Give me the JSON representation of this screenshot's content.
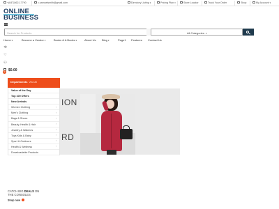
{
  "topbar": {
    "phone": "+(647)562-17790",
    "email": "c.samuelsmith@gmail.com",
    "currency": "Directory Listing",
    "language": "Pricing Plan",
    "store_locator": "Store Locator",
    "track_order": "Track Your Order",
    "shop": "Shop",
    "account": "My Account"
  },
  "logo": {
    "line1": "ONLINE",
    "line2": "BUSINESS"
  },
  "search": {
    "placeholder": "Search for Products",
    "category": "All Categories"
  },
  "nav": [
    {
      "label": "Home",
      "has_caret": true
    },
    {
      "label": "Become a Vendor",
      "has_caret": true
    },
    {
      "label": "Books & A Books",
      "has_caret": true
    },
    {
      "label": "About Us",
      "has_caret": false
    },
    {
      "label": "Blog",
      "has_caret": true
    },
    {
      "label": "Page1",
      "has_caret": false
    },
    {
      "label": "Features",
      "has_caret": false
    },
    {
      "label": "Contact Us",
      "has_caret": false
    }
  ],
  "header_icons": [
    "compare-icon",
    "heart-icon",
    "user-icon"
  ],
  "cart": {
    "count": "0",
    "total": "$0.00"
  },
  "departments": {
    "title": "Departments",
    "view_all": "View All",
    "items": [
      {
        "label": "Value of the Day",
        "bold": true,
        "arrow": false
      },
      {
        "label": "Top 100 Offers",
        "bold": true,
        "arrow": false
      },
      {
        "label": "New Arrivals",
        "bold": true,
        "arrow": false
      },
      {
        "label": "Women Clothing",
        "bold": false,
        "arrow": true
      },
      {
        "label": "Men's Clothing",
        "bold": false,
        "arrow": true
      },
      {
        "label": "Bags & Shoes",
        "bold": false,
        "arrow": true
      },
      {
        "label": "Beauty, Health & Hair",
        "bold": false,
        "arrow": true
      },
      {
        "label": "Jewelry & Watches",
        "bold": false,
        "arrow": true
      },
      {
        "label": "Toys Kids & Baby",
        "bold": false,
        "arrow": true
      },
      {
        "label": "Sport & Outdoors",
        "bold": false,
        "arrow": true
      },
      {
        "label": "Health & Wellness",
        "bold": false,
        "arrow": true
      },
      {
        "label": "Downloadable Products",
        "bold": false,
        "arrow": false
      }
    ]
  },
  "hero": {
    "word1": "ION",
    "word2": "RD"
  },
  "deals": {
    "prefix": "CATCH BIG",
    "highlight": "DEALS",
    "suffix": "ON",
    "line2": "THE CONSOLES",
    "cta": "Shop now"
  },
  "colors": {
    "accent": "#ee4d1b",
    "brand": "#1c3a5e",
    "search_button": "#1f3a4d"
  }
}
